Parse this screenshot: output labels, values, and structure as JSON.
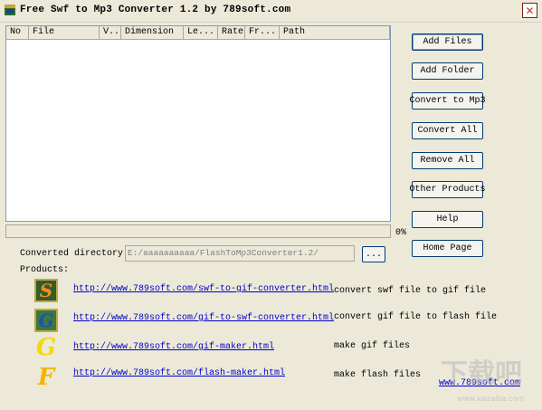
{
  "window": {
    "title": "Free Swf to Mp3 Converter 1.2 by 789soft.com",
    "close_glyph": "✕"
  },
  "list": {
    "columns": [
      "No",
      "File",
      "V..",
      "Dimension",
      "Le...",
      "Rate",
      "Fr...",
      "Path"
    ]
  },
  "progress": {
    "value": 0,
    "percent_label": "0%"
  },
  "buttons": {
    "add_files": "Add  Files",
    "add_folder": "Add  Folder",
    "convert_to_mp3": "Convert to Mp3",
    "convert_all": "Convert  All",
    "remove_all": "Remove  All",
    "other_products": "Other Products",
    "help": "Help",
    "home_page": "Home Page",
    "browse": "..."
  },
  "converted_dir": {
    "label": "Converted directory:",
    "value": "E:/aaaaaaaaaa/FlashToMp3Converter1.2/"
  },
  "products": {
    "label": "Products:",
    "items": [
      {
        "icon_letter": "S",
        "icon": "swf-to-gif-icon",
        "url": "http://www.789soft.com/swf-to-gif-converter.html",
        "desc": "convert swf file to gif file"
      },
      {
        "icon_letter": "G",
        "icon": "gif-to-swf-icon",
        "url": "http://www.789soft.com/gif-to-swf-converter.html",
        "desc": "convert gif file to flash file"
      },
      {
        "icon_letter": "G",
        "icon": "gif-maker-icon",
        "url": "http://www.789soft.com/gif-maker.html",
        "desc": "make gif files"
      },
      {
        "icon_letter": "F",
        "icon": "flash-maker-icon",
        "url": "http://www.789soft.com/flash-maker.html",
        "desc": "make flash files"
      }
    ]
  },
  "footer": {
    "site_link": "www.789soft.com"
  },
  "watermark": {
    "line1": "下载吧",
    "line2": "www.xiazaiba.com"
  },
  "colors": {
    "link": "#0000cc",
    "window_bg": "#ece9d8",
    "button_border": "#003c74"
  }
}
